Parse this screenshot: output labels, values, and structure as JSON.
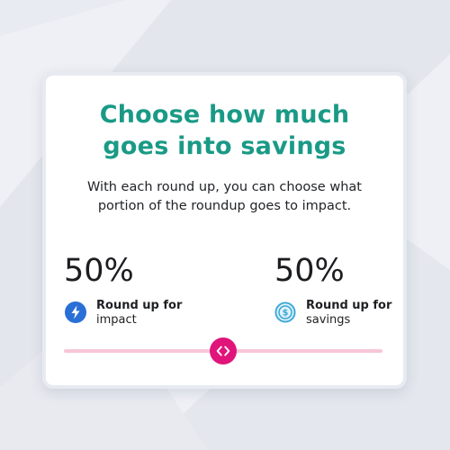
{
  "card": {
    "title_line1": "Choose how much",
    "title_line2": "goes into savings",
    "description_line1": "With each round up, you can choose what",
    "description_line2": "portion of the roundup goes to impact."
  },
  "impact": {
    "percent": "50%",
    "label_bold": "Round up for",
    "label_plain": "impact",
    "icon": "lightning-bolt-icon"
  },
  "savings": {
    "percent": "50%",
    "label_bold": "Round up for",
    "label_plain": "savings",
    "icon": "dollar-coin-icon"
  },
  "slider": {
    "value": 0.5,
    "thumb_icon": "chevrons-left-right-icon"
  },
  "colors": {
    "title": "#1a9a86",
    "impact_icon": "#2a6fd6",
    "savings_icon": "#3aa7d6",
    "track": "#f7c6d8",
    "thumb": "#e0147b"
  }
}
